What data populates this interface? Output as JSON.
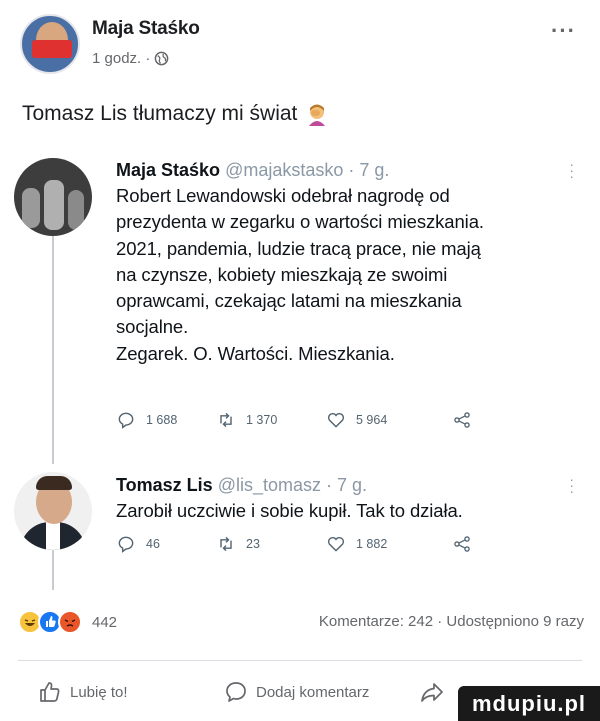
{
  "post": {
    "author": "Maja Staśko",
    "time": "1 godz. ·",
    "text": "Tomasz Lis tłumaczy mi świat"
  },
  "tweets": [
    {
      "name": "Maja Staśko",
      "handle": "@majakstasko · 7 g.",
      "body": "Robert Lewandowski odebrał nagrodę od\nprezydenta w zegarku o wartości mieszkania.\n2021, pandemia, ludzie tracą prace, nie mają\nna czynsze, kobiety mieszkają ze swoimi\noprawcami, czekając latami na mieszkania\nsocjalne.\nZegarek. O. Wartości. Mieszkania.",
      "replies": "1 688",
      "retweets": "1 370",
      "likes": "5 964"
    },
    {
      "name": "Tomasz Lis",
      "handle": "@lis_tomasz · 7 g.",
      "body": "Zarobił uczciwie i sobie kupił. Tak to działa.",
      "replies": "46",
      "retweets": "23",
      "likes": "1 882"
    }
  ],
  "reactions": {
    "count": "442",
    "summary": "Komentarze: 242 · Udostępniono 9 razy"
  },
  "actions": {
    "like_label": "Lubię to!",
    "comment_label": "Dodaj komentarz"
  },
  "watermark": "mdupiu.pl",
  "colors": {
    "fb_blue": "#1877f2",
    "haha": "#f7c23c",
    "angry": "#e8562a",
    "muted": "#65676b"
  }
}
